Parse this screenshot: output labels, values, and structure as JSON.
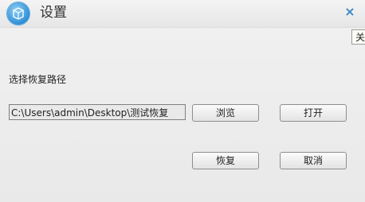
{
  "window": {
    "title": "设置",
    "close_glyph": "×",
    "close_tooltip": "关",
    "icon": "app-logo-icon"
  },
  "main": {
    "path_label": "选择恢复路径",
    "path_value": "C:\\Users\\admin\\Desktop\\测试恢复",
    "browse_label": "浏览",
    "open_label": "打开",
    "restore_label": "恢复",
    "cancel_label": "取消"
  },
  "colors": {
    "accent": "#3a86c8",
    "icon_blue": "#2f8fd6"
  }
}
